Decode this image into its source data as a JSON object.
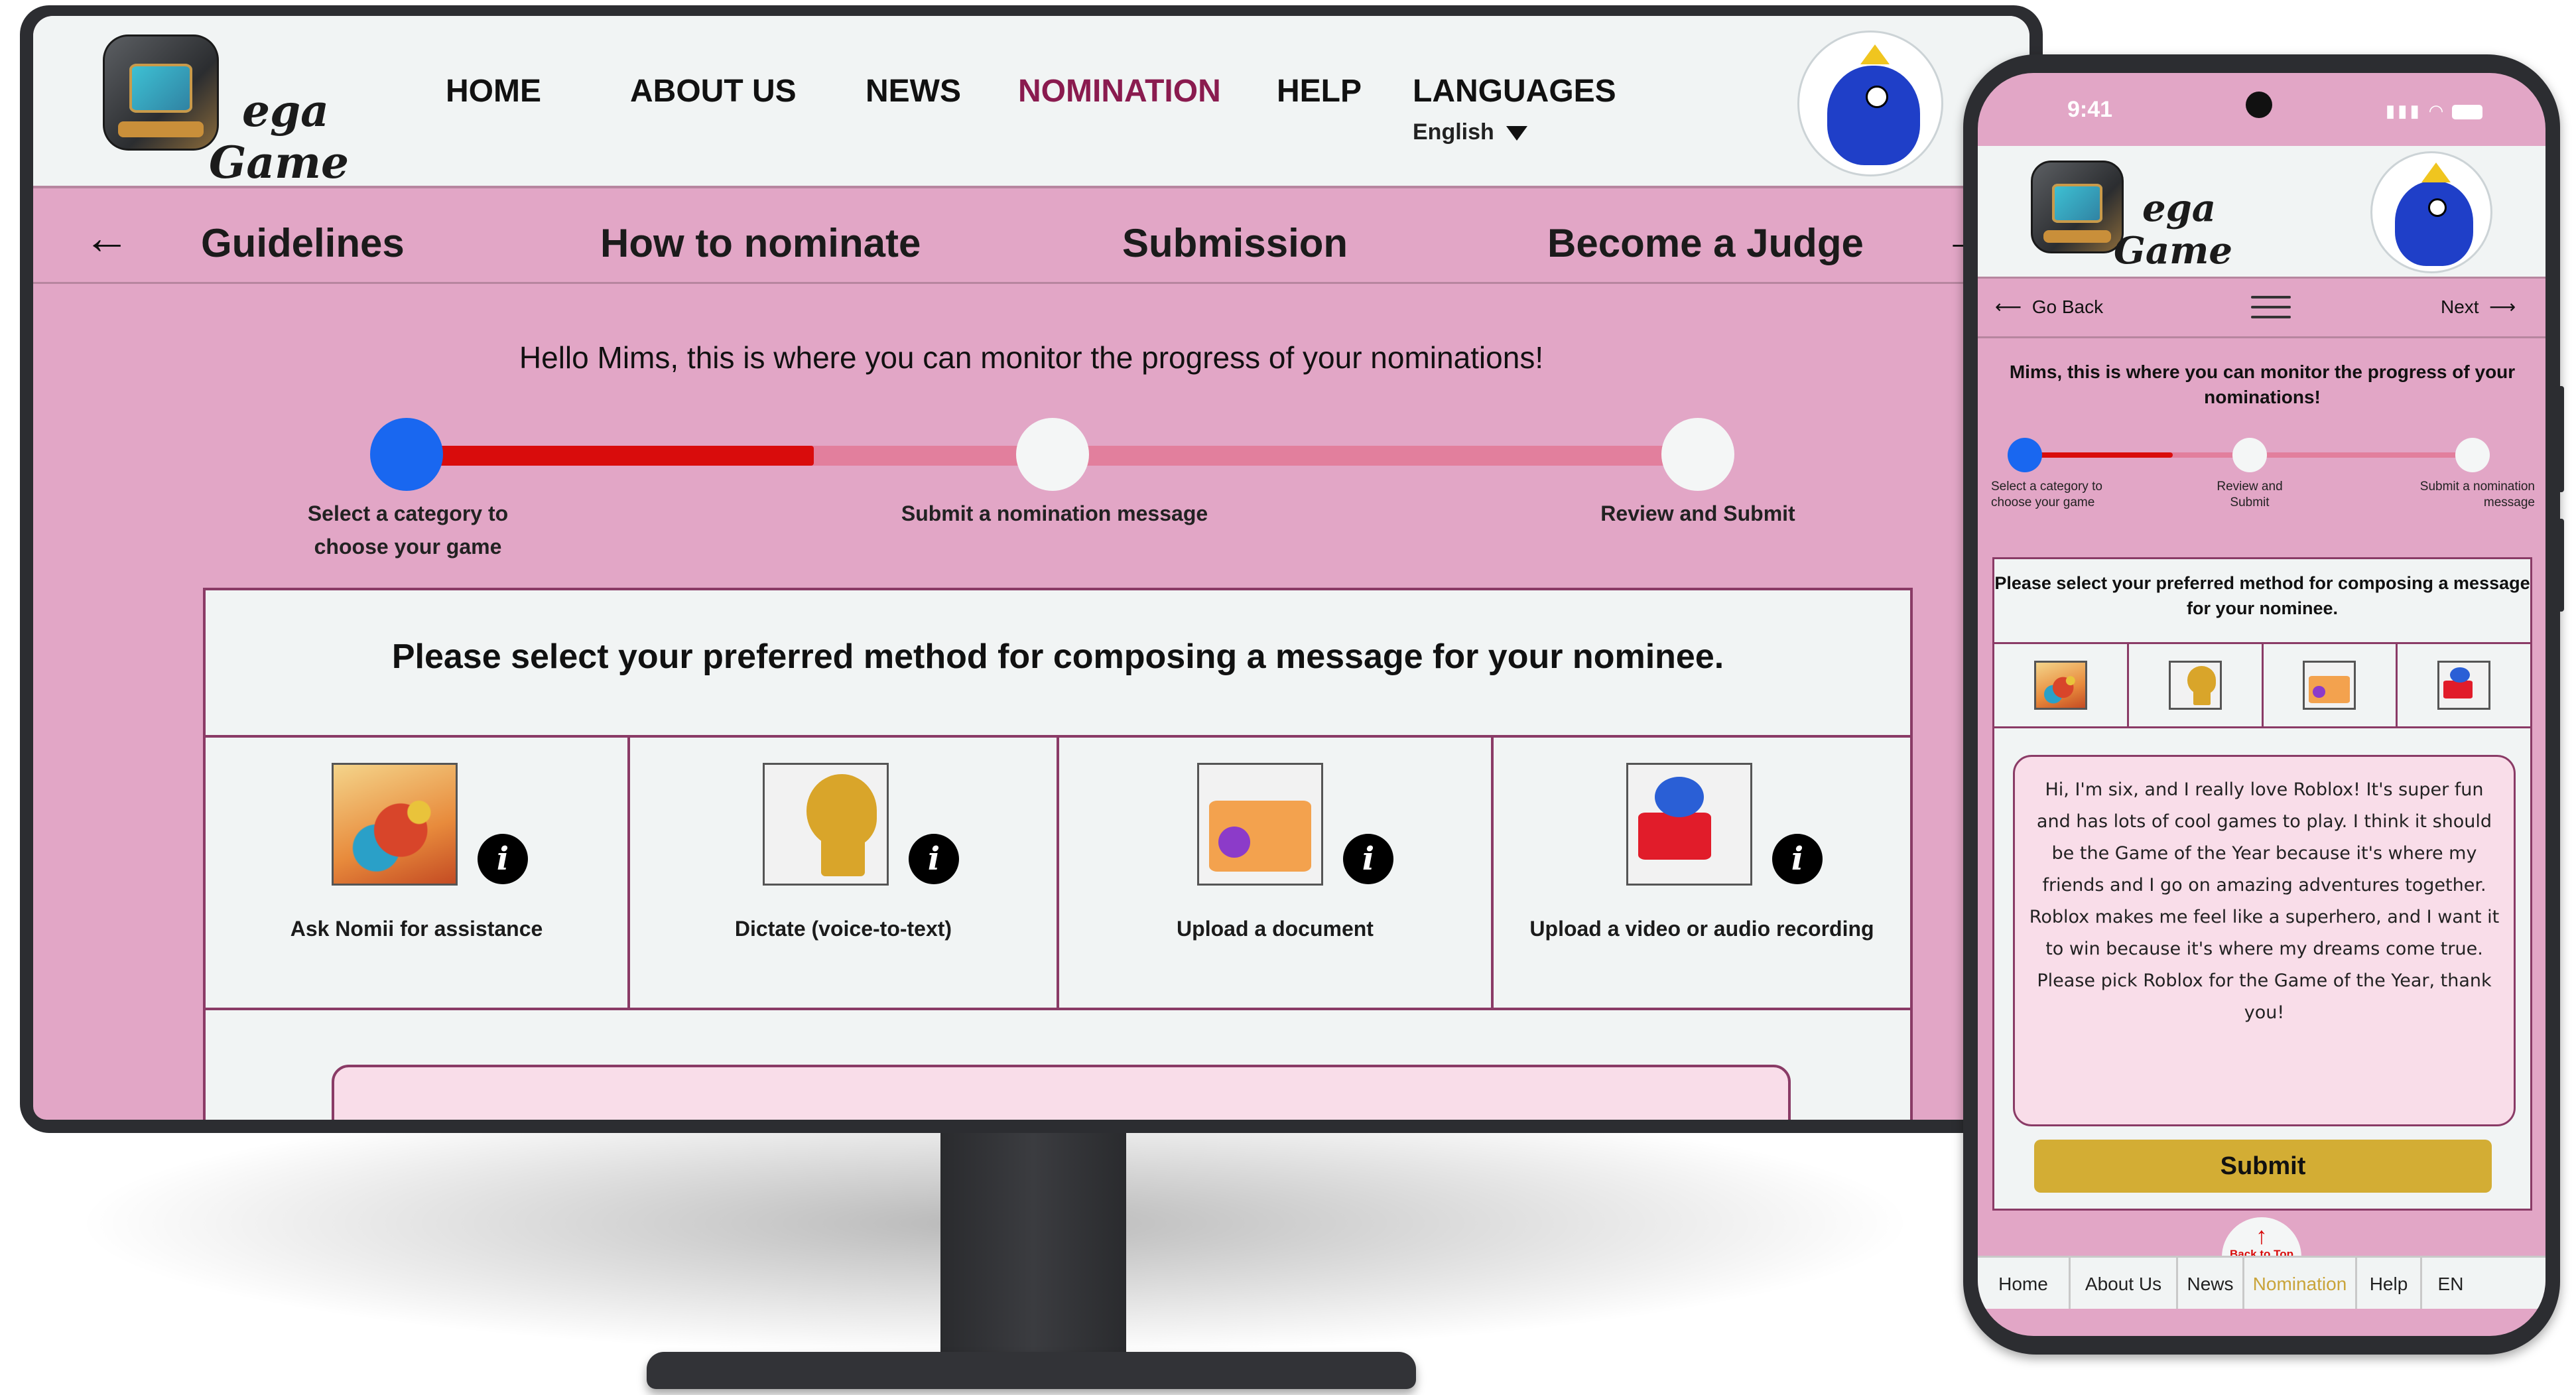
{
  "desktop": {
    "nav": {
      "home": "HOME",
      "about": "ABOUT US",
      "news": "NEWS",
      "nomination": "NOMINATION",
      "help": "HELP",
      "languages": "LANGUAGES",
      "language_selected": "English"
    },
    "logo": {
      "line1": "ega",
      "line2": "Game"
    },
    "subnav": {
      "back_arrow": "←",
      "items": [
        "Guidelines",
        "How to nominate",
        "Submission",
        "Become a Judge"
      ],
      "forward_arrow": "→"
    },
    "greeting": "Hello Mims, this is where you can monitor the progress of your nominations!",
    "progress": {
      "fraction": 0.33,
      "steps": [
        "Select a category to choose your game",
        "Submit a nomination message",
        "Review and Submit"
      ]
    },
    "method": {
      "title": "Please select your preferred method for composing a message for your nominee.",
      "options": [
        "Ask Nomii for assistance",
        "Dictate (voice-to-text)",
        "Upload a document",
        "Upload a video or audio recording"
      ],
      "info_glyph": "i"
    }
  },
  "phone": {
    "status": {
      "time": "9:41"
    },
    "logo": {
      "line1": "ega",
      "line2": "Game"
    },
    "toolbar": {
      "back": "Go Back",
      "next": "Next"
    },
    "greeting": "Mims, this is where you can monitor the progress of your nominations!",
    "progress": {
      "fraction": 0.33,
      "steps": [
        "Select a category to choose your game",
        "Review and Submit",
        "Submit a nomination message"
      ]
    },
    "method_title": "Please select your preferred method for composing a message for your nominee.",
    "message": "Hi, I'm six, and I really love Roblox! It's super fun and has lots of cool games to play. I think it should be the Game of the Year because it's where my friends and I go on amazing adventures together. Roblox makes me feel like a superhero, and I want it to win because it's where my dreams come true. Please pick Roblox for the Game of the Year, thank you!",
    "submit": "Submit",
    "back_to_top": "Back to Top",
    "bottom_nav": [
      "Home",
      "About Us",
      "News",
      "Nomination",
      "Help",
      "EN"
    ]
  },
  "colors": {
    "page_pink": "#e2a6c6",
    "panel": "#f1f4f4",
    "accent_border": "#8a3b66",
    "progress_fill": "#d90c0c",
    "progress_track": "#e27f9d",
    "active_step": "#1967f0",
    "nav_active": "#8a1b4f",
    "submit": "#d3ad34"
  }
}
